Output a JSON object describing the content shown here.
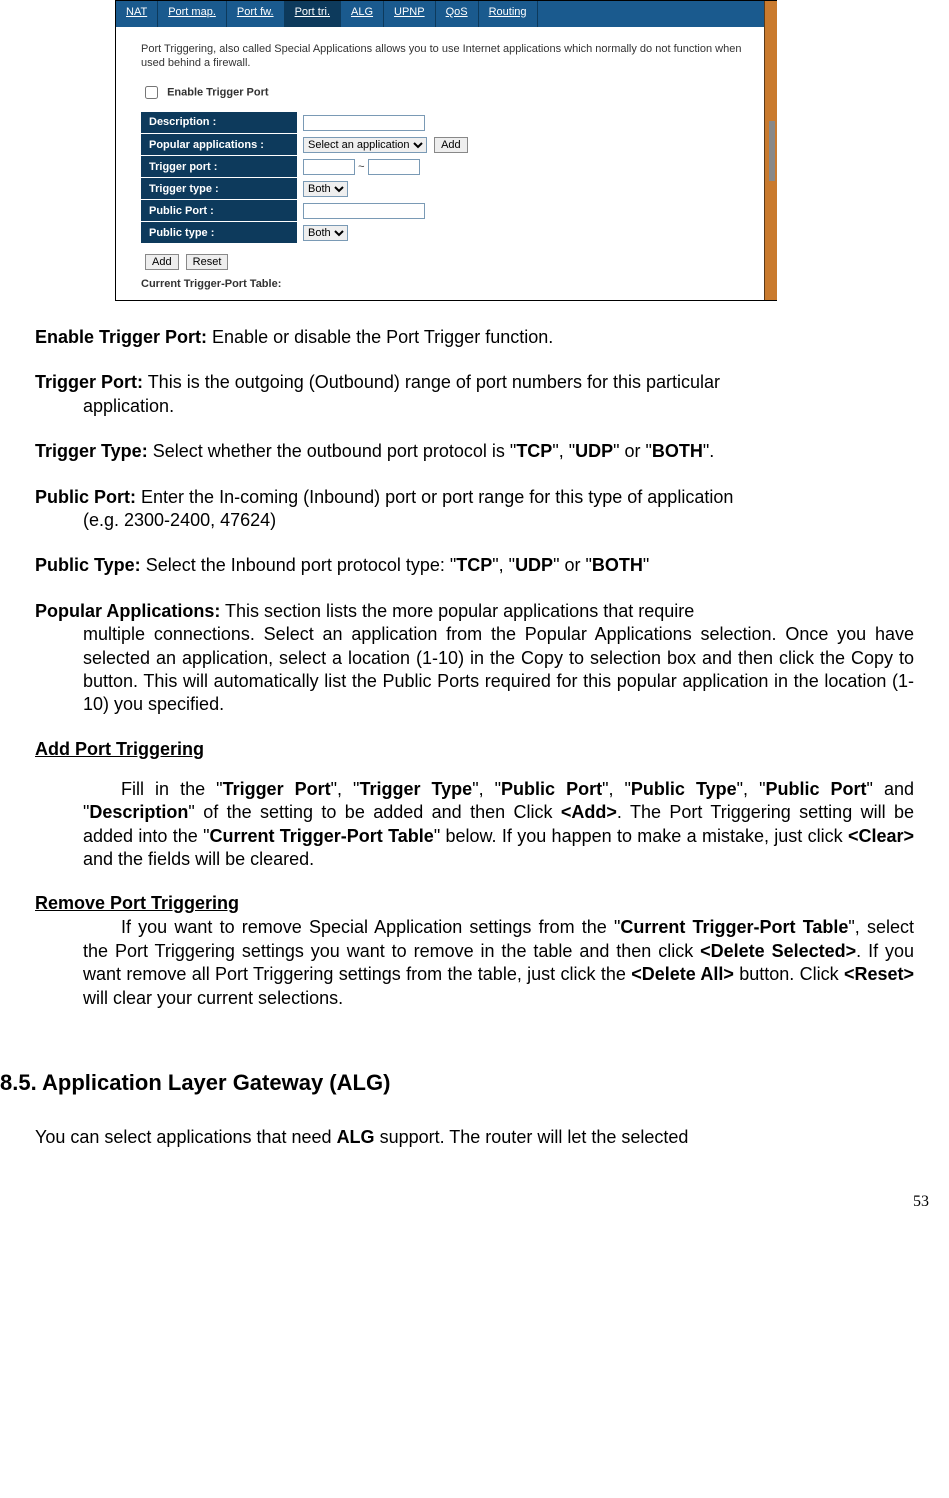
{
  "screenshot": {
    "tabs": [
      "NAT",
      "Port map.",
      "Port fw.",
      "Port tri.",
      "ALG",
      "UPNP",
      "QoS",
      "Routing"
    ],
    "active_tab_index": 3,
    "intro": "Port Triggering, also called Special Applications allows you to use Internet applications which normally do not function when used behind a firewall.",
    "enable_label": "Enable Trigger Port",
    "rows": {
      "description": "Description :",
      "popular": "Popular applications :",
      "popular_select": "Select an application",
      "add_btn": "Add",
      "trigger_port": "Trigger port :",
      "tilde": "~",
      "trigger_type": "Trigger type :",
      "both": "Both",
      "public_port": "Public Port :",
      "public_type": "Public type :"
    },
    "action_add": "Add",
    "action_reset": "Reset",
    "current_table_label": "Current Trigger-Port Table:"
  },
  "defs": {
    "enable_trigger_port": {
      "term": "Enable Trigger Port:",
      "body": " Enable or disable the Port Trigger function."
    },
    "trigger_port": {
      "term": "Trigger Port:",
      "body1": " This is the outgoing (Outbound) range of port numbers for this particular ",
      "body2": "application."
    },
    "trigger_type": {
      "term": "Trigger Type:",
      "pre": " Select whether the outbound port protocol is \"",
      "tcp": "TCP",
      "mid1": "\", \"",
      "udp": "UDP",
      "mid2": "\" or \"",
      "both": "BOTH",
      "end": "\"."
    },
    "public_port": {
      "term": "Public Port:",
      "body1": " Enter the In-coming (Inbound) port or port range for this type of application ",
      "body2": "(e.g. 2300-2400, 47624)"
    },
    "public_type": {
      "term": "Public Type:",
      "pre": " Select the Inbound port protocol type: \"",
      "tcp": "TCP",
      "mid1": "\", \"",
      "udp": "UDP",
      "mid2": "\" or \"",
      "both": "BOTH",
      "end": "\""
    },
    "popular_apps": {
      "term": "Popular Applications:",
      "body1": " This section lists the more popular applications that require ",
      "body2": "multiple connections. Select an application from the Popular Applications selection. Once you have selected an application, select a location (1-10) in the Copy to selection box and then click the Copy to button. This will automatically list the Public Ports required for this popular application in the location (1-10) you specified."
    }
  },
  "add_heading": "Add Port Triggering",
  "add_para": {
    "p1": "Fill in the \"",
    "b1": "Trigger Port",
    "p2": "\", \"",
    "b2": "Trigger Type",
    "p3": "\", \"",
    "b3": "Public Port",
    "p4": "\", \"",
    "b4": "Public Type",
    "p5": "\", \"",
    "b5": "Public Port",
    "p6": "\" and \"",
    "b6": "Description",
    "p7": "\" of the setting to be added and then Click ",
    "b7": "<Add>",
    "p8": ". The Port Triggering setting will be added into the \"",
    "b8": "Current Trigger-Port Table",
    "p9": "\" below. If you happen to make a mistake, just click ",
    "b9": "<Clear>",
    "p10": " and the fields will be cleared."
  },
  "remove_heading": "Remove Port Triggering",
  "remove_para": {
    "p1": "If you want to remove Special Application settings from the \"",
    "b1": "Current Trigger-Port Table",
    "p2": "\", select the Port Triggering settings you want to remove in the table and then click ",
    "b2": "<Delete Selected>",
    "p3": ". If you want remove all Port Triggering settings from the table, just click the ",
    "b3": "<Delete All>",
    "p4": " button. Click ",
    "b4": "<Reset>",
    "p5": " will clear your current selections."
  },
  "section_title": "8.5. Application Layer Gateway (ALG)",
  "alg_para": {
    "p1": "You can select applications that need ",
    "b1": "ALG",
    "p2": " support. The router will let the selected"
  },
  "page_num": "53"
}
